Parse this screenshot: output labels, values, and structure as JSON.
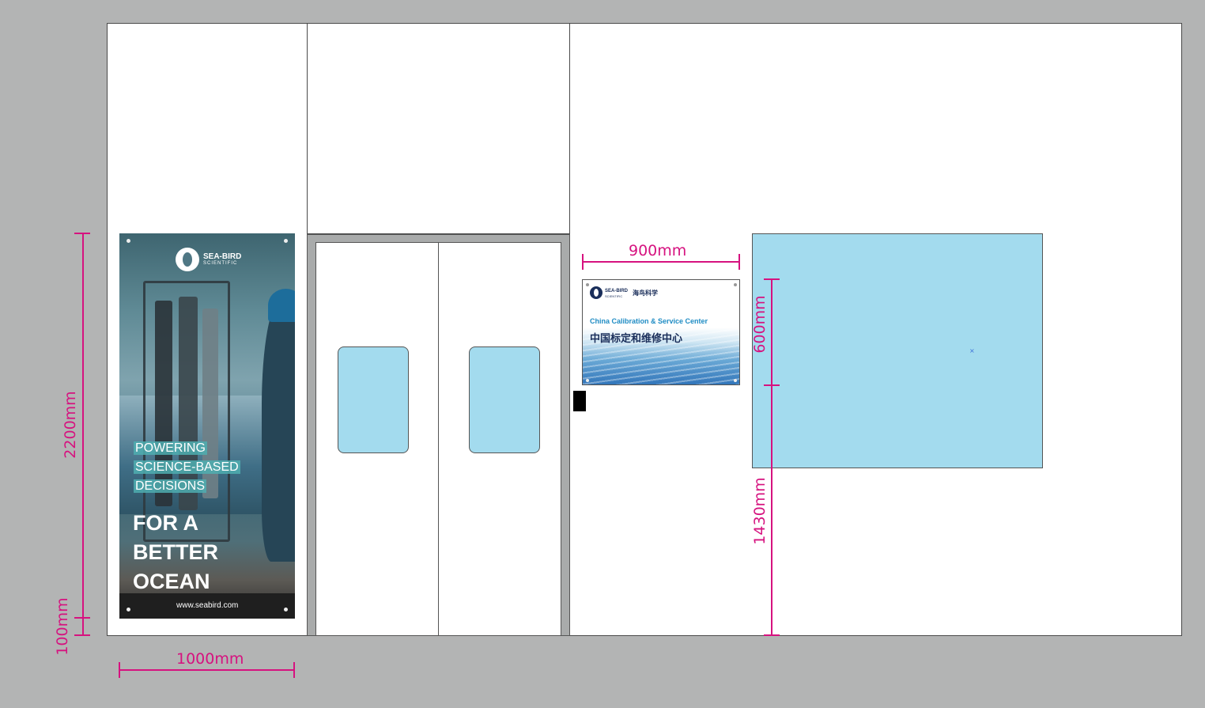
{
  "banner": {
    "logo_name": "SEA-BIRD",
    "logo_sub": "SCIENTIFIC",
    "slogan_lines": [
      "POWERING",
      "SCIENCE-BASED",
      "DECISIONS"
    ],
    "headline_lines": [
      "FOR A",
      "BETTER",
      "OCEAN"
    ],
    "url": "www.seabird.com"
  },
  "plaque": {
    "logo_name": "SEA-BIRD",
    "logo_sub": "SCIENTIFIC",
    "brand_cn": "海鸟科学",
    "title_en": "China Calibration & Service Center",
    "title_cn": "中国标定和维修中心"
  },
  "dimensions": {
    "banner_height": "2200mm",
    "banner_offset": "100mm",
    "banner_width": "1000mm",
    "plaque_width": "900mm",
    "plaque_height": "600mm",
    "plaque_offset": "1430mm"
  },
  "colors": {
    "background": "#b3b4b4",
    "dimension": "#d6127f",
    "glass": "#a3dbee"
  }
}
